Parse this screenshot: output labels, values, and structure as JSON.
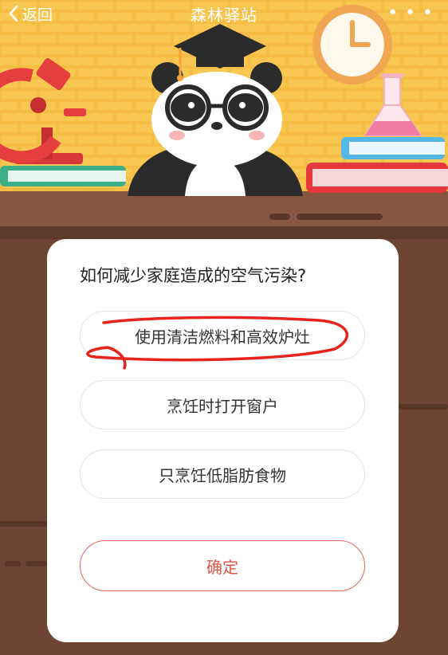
{
  "nav": {
    "back_label": "返回",
    "title": "森林驿站",
    "more_label": "• • •"
  },
  "quiz": {
    "question": "如何减少家庭造成的空气污染?",
    "options": [
      {
        "label": "使用清洁燃料和高效炉灶"
      },
      {
        "label": "烹饪时打开窗户"
      },
      {
        "label": "只烹饪低脂肪食物"
      }
    ],
    "confirm_label": "确定"
  },
  "colors": {
    "background_yellow": "#f7c04a",
    "desk_brown": "#6b4431",
    "confirm_red": "#e0544a",
    "annotation_red": "#e8231b"
  },
  "icons": [
    "chevron-left-icon",
    "more-icon",
    "panda-mascot",
    "microscope-icon",
    "clock-icon",
    "flask-icon",
    "book-icon"
  ]
}
